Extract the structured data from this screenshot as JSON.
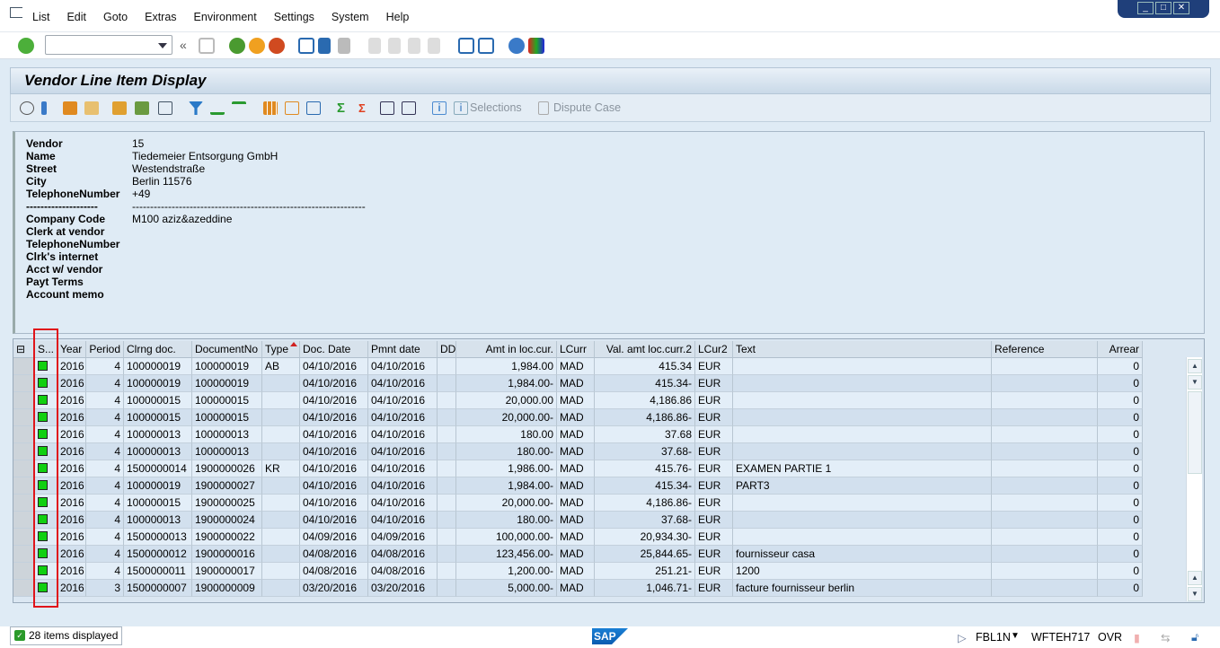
{
  "menu": {
    "items": [
      "List",
      "Edit",
      "Goto",
      "Extras",
      "Environment",
      "Settings",
      "System",
      "Help"
    ]
  },
  "toolbar": {
    "command_value": ""
  },
  "title": "Vendor Line Item Display",
  "app_toolbar": {
    "selections": "Selections",
    "dispute_case": "Dispute Case"
  },
  "header": {
    "fields": [
      {
        "label": "Vendor",
        "value": "15"
      },
      {
        "label": "Name",
        "value": "Tiedemeier Entsorgung GmbH"
      },
      {
        "label": "Street",
        "value": "Westendstraße"
      },
      {
        "label": "City",
        "value": "Berlin 11576"
      },
      {
        "label": "TelephoneNumber",
        "value": "+49"
      },
      {
        "label": "--------------------",
        "value": "-----------------------------------------------------------------"
      },
      {
        "label": "Company Code",
        "value": "M100 aziz&azeddine"
      },
      {
        "label": "Clerk at vendor",
        "value": ""
      },
      {
        "label": "TelephoneNumber",
        "value": ""
      },
      {
        "label": "Clrk's internet",
        "value": ""
      },
      {
        "label": "Acct w/ vendor",
        "value": ""
      },
      {
        "label": "Payt Terms",
        "value": ""
      },
      {
        "label": "Account memo",
        "value": ""
      }
    ]
  },
  "grid": {
    "columns": [
      "S...",
      "Year",
      "Period",
      "Clrng doc.",
      "DocumentNo",
      "Type",
      "Doc. Date",
      "Pmnt date",
      "DD",
      "Amt in loc.cur.",
      "LCurr",
      "Val. amt loc.curr.2",
      "LCur2",
      "Text",
      "Reference",
      "Arrear"
    ],
    "sort_column": "Type",
    "status_color": "#11d011",
    "rows": [
      [
        "2016",
        "4",
        "100000019",
        "100000019",
        "AB",
        "04/10/2016",
        "04/10/2016",
        "",
        "1,984.00",
        "MAD",
        "415.34",
        "EUR",
        "",
        "",
        "0"
      ],
      [
        "2016",
        "4",
        "100000019",
        "100000019",
        "",
        "04/10/2016",
        "04/10/2016",
        "",
        "1,984.00-",
        "MAD",
        "415.34-",
        "EUR",
        "",
        "",
        "0"
      ],
      [
        "2016",
        "4",
        "100000015",
        "100000015",
        "",
        "04/10/2016",
        "04/10/2016",
        "",
        "20,000.00",
        "MAD",
        "4,186.86",
        "EUR",
        "",
        "",
        "0"
      ],
      [
        "2016",
        "4",
        "100000015",
        "100000015",
        "",
        "04/10/2016",
        "04/10/2016",
        "",
        "20,000.00-",
        "MAD",
        "4,186.86-",
        "EUR",
        "",
        "",
        "0"
      ],
      [
        "2016",
        "4",
        "100000013",
        "100000013",
        "",
        "04/10/2016",
        "04/10/2016",
        "",
        "180.00",
        "MAD",
        "37.68",
        "EUR",
        "",
        "",
        "0"
      ],
      [
        "2016",
        "4",
        "100000013",
        "100000013",
        "",
        "04/10/2016",
        "04/10/2016",
        "",
        "180.00-",
        "MAD",
        "37.68-",
        "EUR",
        "",
        "",
        "0"
      ],
      [
        "2016",
        "4",
        "1500000014",
        "1900000026",
        "KR",
        "04/10/2016",
        "04/10/2016",
        "",
        "1,986.00-",
        "MAD",
        "415.76-",
        "EUR",
        "EXAMEN PARTIE 1",
        "",
        "0"
      ],
      [
        "2016",
        "4",
        "100000019",
        "1900000027",
        "",
        "04/10/2016",
        "04/10/2016",
        "",
        "1,984.00-",
        "MAD",
        "415.34-",
        "EUR",
        "PART3",
        "",
        "0"
      ],
      [
        "2016",
        "4",
        "100000015",
        "1900000025",
        "",
        "04/10/2016",
        "04/10/2016",
        "",
        "20,000.00-",
        "MAD",
        "4,186.86-",
        "EUR",
        "",
        "",
        "0"
      ],
      [
        "2016",
        "4",
        "100000013",
        "1900000024",
        "",
        "04/10/2016",
        "04/10/2016",
        "",
        "180.00-",
        "MAD",
        "37.68-",
        "EUR",
        "",
        "",
        "0"
      ],
      [
        "2016",
        "4",
        "1500000013",
        "1900000022",
        "",
        "04/09/2016",
        "04/09/2016",
        "",
        "100,000.00-",
        "MAD",
        "20,934.30-",
        "EUR",
        "",
        "",
        "0"
      ],
      [
        "2016",
        "4",
        "1500000012",
        "1900000016",
        "",
        "04/08/2016",
        "04/08/2016",
        "",
        "123,456.00-",
        "MAD",
        "25,844.65-",
        "EUR",
        "fournisseur casa",
        "",
        "0"
      ],
      [
        "2016",
        "4",
        "1500000011",
        "1900000017",
        "",
        "04/08/2016",
        "04/08/2016",
        "",
        "1,200.00-",
        "MAD",
        "251.21-",
        "EUR",
        "1200",
        "",
        "0"
      ],
      [
        "2016",
        "3",
        "1500000007",
        "1900000009",
        "",
        "03/20/2016",
        "03/20/2016",
        "",
        "5,000.00-",
        "MAD",
        "1,046.71-",
        "EUR",
        "facture fournisseur berlin",
        "",
        "0"
      ]
    ]
  },
  "status": {
    "message": "28 items displayed",
    "transaction": "FBL1N",
    "server": "WFTEH717",
    "mode": "OVR",
    "logo": "SAP"
  }
}
